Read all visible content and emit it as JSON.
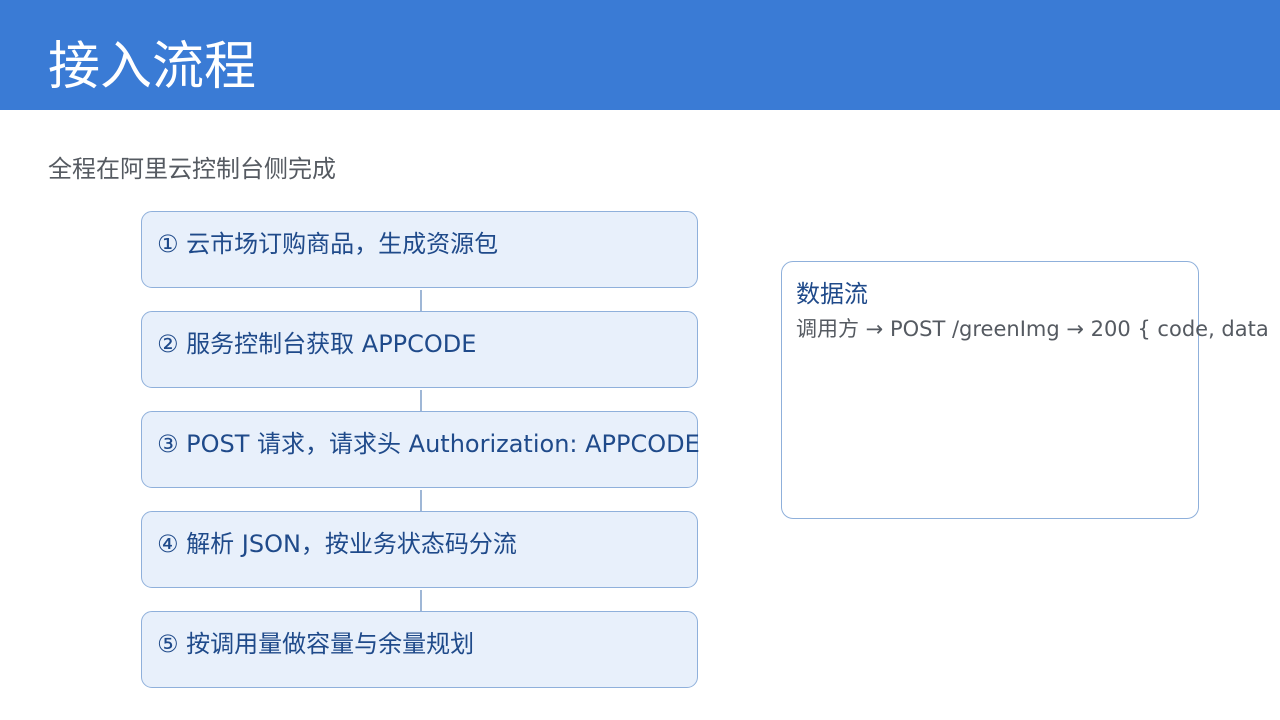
{
  "header": {
    "title": "接入流程"
  },
  "subtitle": "全程在阿里云控制台侧完成",
  "steps": [
    {
      "label": "① 云市场订购商品，生成资源包"
    },
    {
      "label": "② 服务控制台获取 APPCODE"
    },
    {
      "label": "③ POST 请求，请求头 Authorization: APPCODE"
    },
    {
      "label": "④ 解析 JSON，按业务状态码分流"
    },
    {
      "label": "⑤ 按调用量做容量与余量规划"
    }
  ],
  "data_flow": {
    "title": "数据流",
    "description": "调用方 → POST /greenImg → 200 { code, data"
  },
  "colors": {
    "header_bg": "#3a7bd5",
    "step_bg": "#e8f0fb",
    "step_border": "#8fb0db",
    "step_text": "#1f4a8a",
    "body_text": "#555a61"
  }
}
